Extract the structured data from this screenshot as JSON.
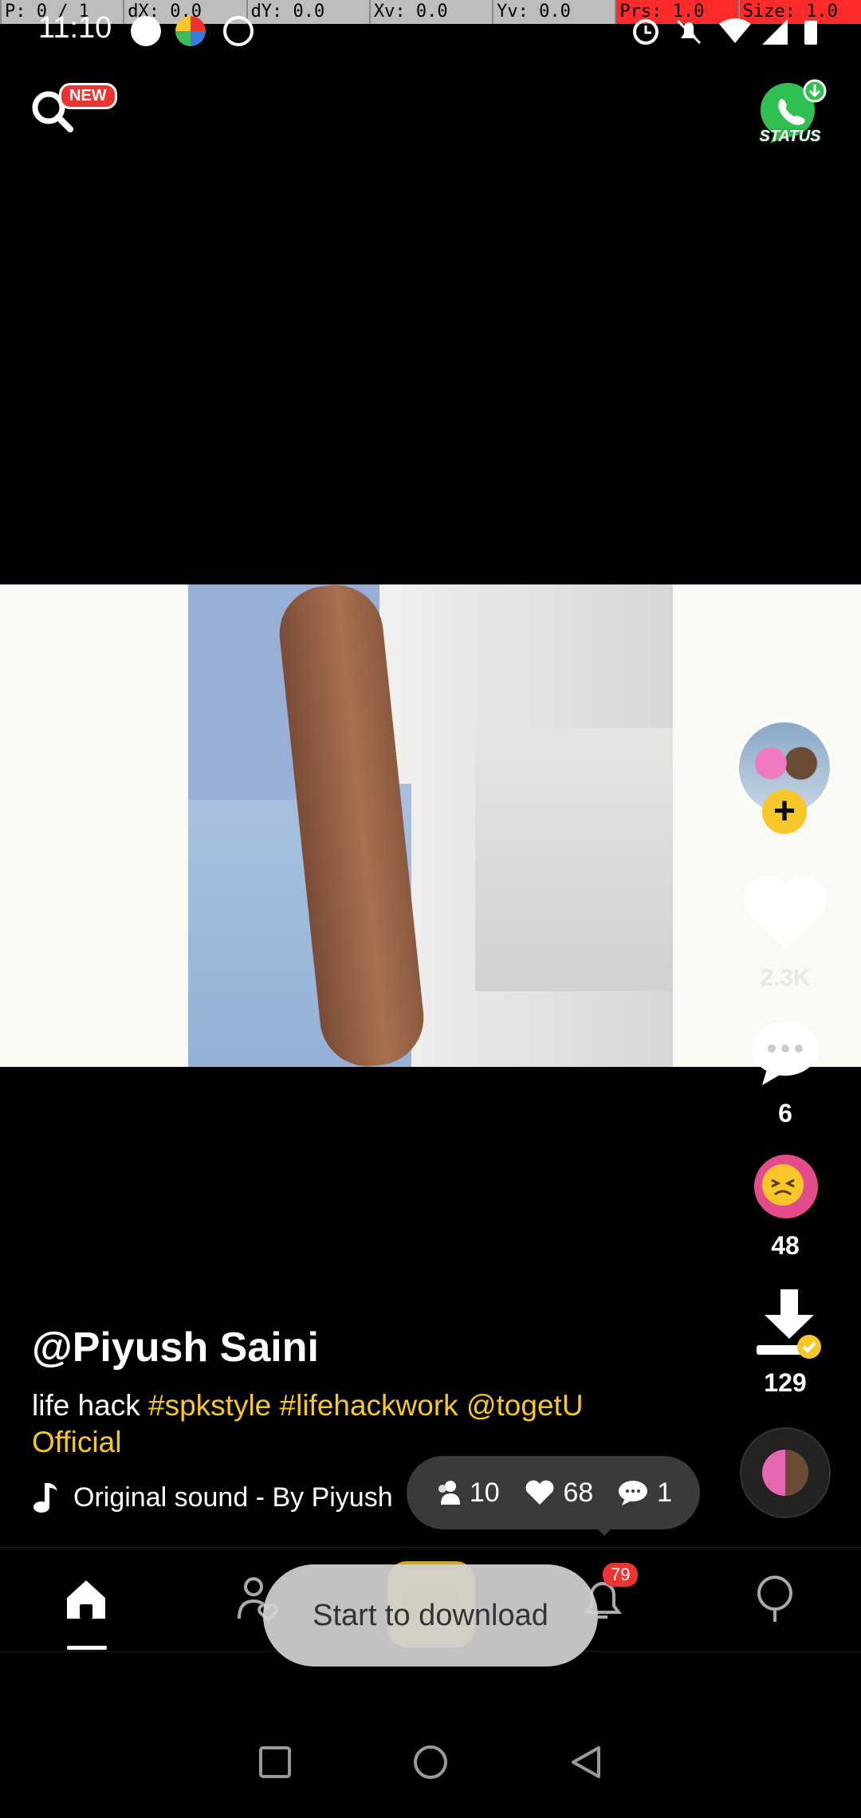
{
  "debug_bar": [
    "P: 0 / 1",
    "dX: 0.0",
    "dY: 0.0",
    "Xv: 0.0",
    "Yv: 0.0",
    "Prs: 1.0",
    "Size: 1.0"
  ],
  "status_bar": {
    "time": "11:10"
  },
  "top": {
    "new_badge": "NEW",
    "status_label": "STATUS"
  },
  "video": {
    "likes": "2.3K",
    "comments": "6",
    "reactions": "48",
    "downloads": "129"
  },
  "post": {
    "username": "@Piyush Saini",
    "caption_text": "life hack",
    "hashtags": [
      "#spkstyle",
      "#lifehackwork",
      "@togetU Official"
    ],
    "sound": "Original sound - By Piyush"
  },
  "stats_bubble": {
    "followers": "10",
    "likes": "68",
    "comments": "1"
  },
  "nav": {
    "notification_count": "79"
  },
  "toast": "Start to download",
  "colors": {
    "accent": "#f6c62a",
    "badge": "#e33333"
  }
}
